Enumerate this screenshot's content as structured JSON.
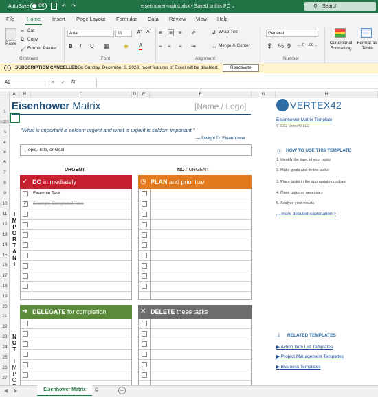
{
  "titlebar": {
    "autosave": "AutoSave",
    "toggle": "Off",
    "doc_title": "eisenhower-matrix.xlsx  •  Saved to this PC ⌄",
    "search": "Search"
  },
  "tabs": [
    "File",
    "Home",
    "Insert",
    "Page Layout",
    "Formulas",
    "Data",
    "Review",
    "View",
    "Help"
  ],
  "ribbon": {
    "paste": "Paste",
    "cut": "Cut",
    "copy": "Copy",
    "format_painter": "Format Painter",
    "clipboard": "Clipboard",
    "font_name": "Arial",
    "font_size": "11",
    "bold": "B",
    "italic": "I",
    "underline": "U",
    "font_color_letter": "A",
    "font_group": "Font",
    "wrap": "Wrap Text",
    "merge": "Merge & Center",
    "alignment": "Alignment",
    "number_format": "General",
    "currency": "$",
    "percent": "%",
    "comma": "9",
    "number": "Number",
    "conditional": "Conditional Formatting",
    "format_table": "Format as Table"
  },
  "message": {
    "label": "SUBSCRIPTION CANCELLED",
    "text": "On Sunday, December 3, 2023, most features of Excel will be disabled.",
    "button": "Reactivate"
  },
  "formula_bar": {
    "name_box": "A2",
    "fx": "fx"
  },
  "columns": [
    "A",
    "B",
    "C",
    "D",
    "E",
    "F",
    "G",
    "H"
  ],
  "rows": [
    "1",
    "2",
    "3",
    "4",
    "5",
    "6",
    "7",
    "8",
    "9",
    "10",
    "11",
    "12",
    "13",
    "14",
    "15",
    "16",
    "17",
    "18",
    "19",
    "20",
    "21",
    "22",
    "23",
    "24",
    "25",
    "26",
    "27"
  ],
  "sheet": {
    "title_bold": "Eisenhower",
    "title_rest": " Matrix",
    "name_logo": "[Name / Logo]",
    "quote": "\"What is important is seldom urgent and what is urgent is seldom important.\"",
    "quote_author": "— Dwight D. Eisenhower",
    "topic": "[Topic, Title, or Goal]",
    "urgent": "URGENT",
    "not_urgent_bold": "NOT",
    "not_urgent_rest": " URGENT",
    "important_letters": [
      "I",
      "M",
      "P",
      "O",
      "R",
      "T",
      "A",
      "N",
      "T"
    ],
    "not_important_letters": [
      "N",
      "O",
      "T",
      "",
      "I",
      "M",
      "P",
      "O",
      "R"
    ],
    "q1_bold": "DO",
    "q1_rest": " immediately",
    "q2_bold": "PLAN",
    "q2_rest": " and prioritize",
    "q3_bold": "DELEGATE",
    "q3_rest": " for completion",
    "q4_bold": "DELETE",
    "q4_rest": " these tasks",
    "task1": "Example Task",
    "task2": "Example Completed Task",
    "colors": {
      "do": "#c8202f",
      "plan": "#e37b1e",
      "delegate": "#5a8a3a",
      "delete": "#6d6d6d",
      "title": "#1f4e79"
    }
  },
  "side": {
    "logo_text": "VERTEX42",
    "template_link": "Eisenhower Matrix Template",
    "copyright": "© 2023 Vertex42 LLC",
    "how_title": "HOW TO USE THIS TEMPLATE",
    "steps": [
      "1. Identify the topic of your tasks",
      "2. Make goals and define tasks",
      "3. Place tasks in the appropriate quadrant",
      "4. Move tasks as necessary",
      "5. Analyze your results"
    ],
    "more_link": "... more detailed explanation >",
    "related_title": "RELATED TEMPLATES",
    "related": [
      "▶ Action Item List Templates",
      "▶ Project Management Templates",
      "▶ Business Templates"
    ]
  },
  "sheet_tabs": {
    "active": "Eisenhower Matrix",
    "copyright_tab": "©",
    "add": "+"
  }
}
